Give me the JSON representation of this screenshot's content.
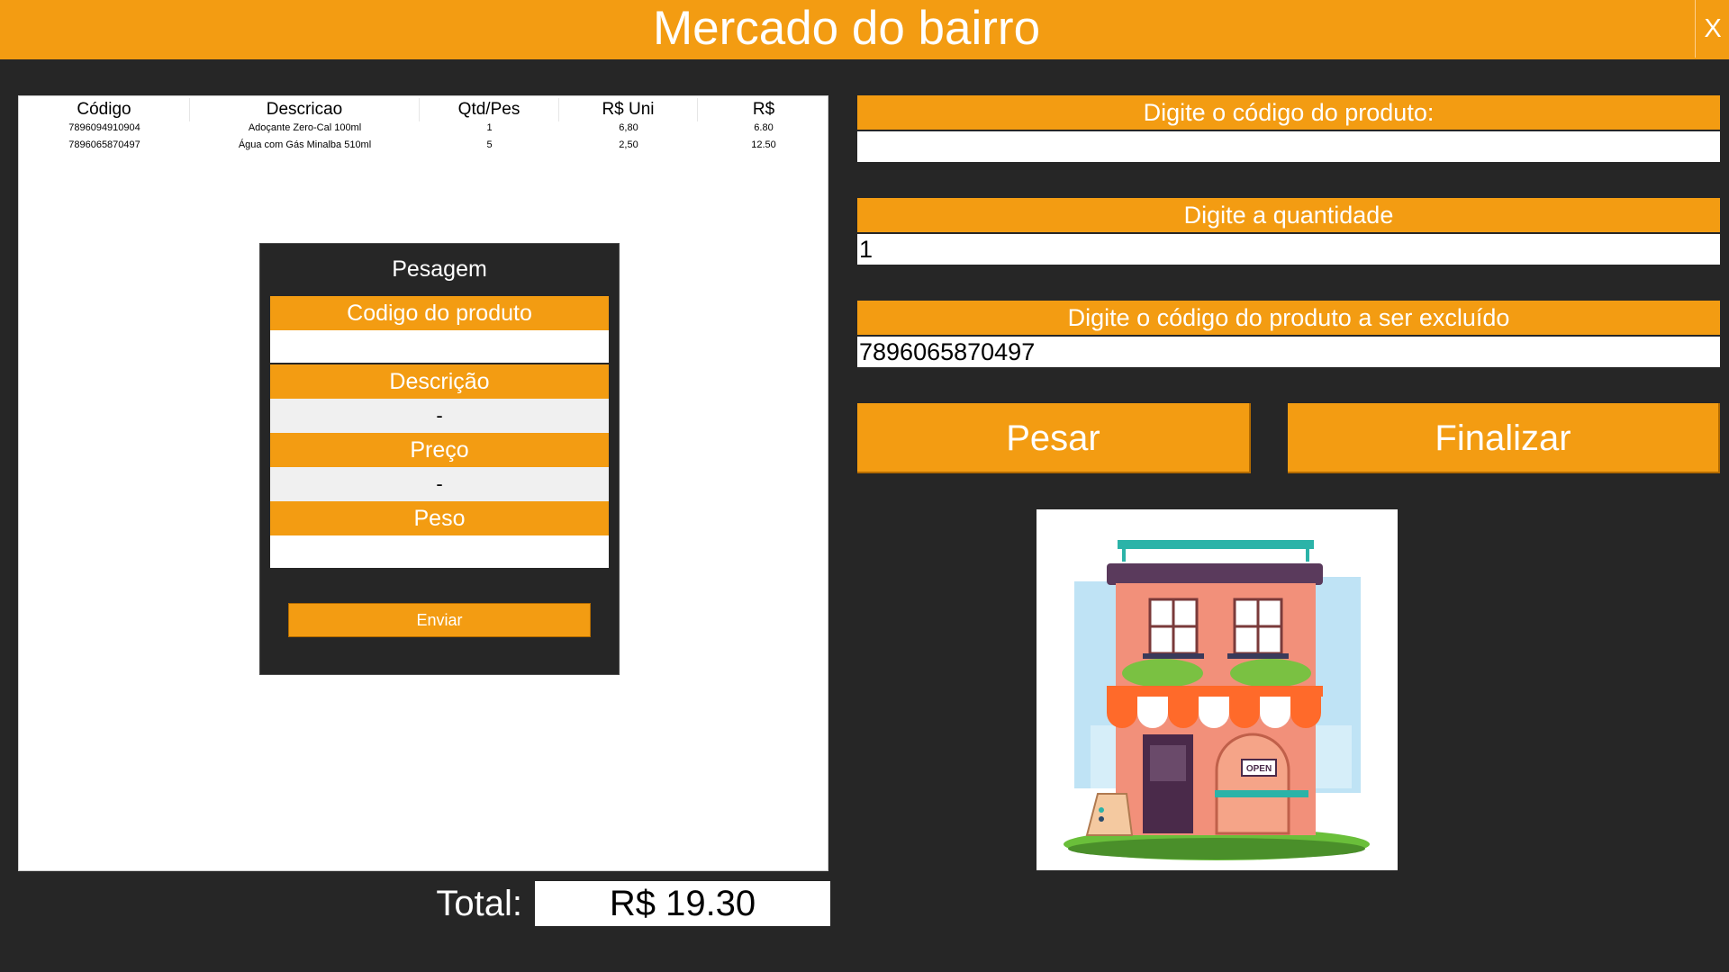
{
  "app": {
    "title": "Mercado do bairro",
    "close_label": "X"
  },
  "table": {
    "columns": [
      "Código",
      "Descricao",
      "Qtd/Pes",
      "R$ Uni",
      "R$"
    ],
    "rows": [
      [
        "7896094910904",
        "Adoçante Zero-Cal 100ml",
        "1",
        "6,80",
        "6.80"
      ],
      [
        "7896065870497",
        "Água com Gás Minalba 510ml",
        "5",
        "2,50",
        "12.50"
      ]
    ]
  },
  "pesagem": {
    "title": "Pesagem",
    "codigo_label": "Codigo do produto",
    "codigo_value": "",
    "descricao_label": "Descrição",
    "descricao_value": "-",
    "preco_label": "Preço",
    "preco_value": "-",
    "peso_label": "Peso",
    "peso_value": "",
    "send_label": "Enviar"
  },
  "total": {
    "label": "Total:",
    "value": "R$ 19.30"
  },
  "form": {
    "codigo_label": "Digite o código do produto:",
    "codigo_value": "",
    "quantidade_label": "Digite a quantidade",
    "quantidade_value": "1",
    "excluir_label": "Digite o código do produto a ser excluído",
    "excluir_value": "7896065870497"
  },
  "buttons": {
    "pesar": "Pesar",
    "finalizar": "Finalizar"
  },
  "image": {
    "sign_text": "OPEN"
  },
  "colors": {
    "accent": "#f39c12",
    "background": "#262626",
    "field": "#ffffff"
  }
}
